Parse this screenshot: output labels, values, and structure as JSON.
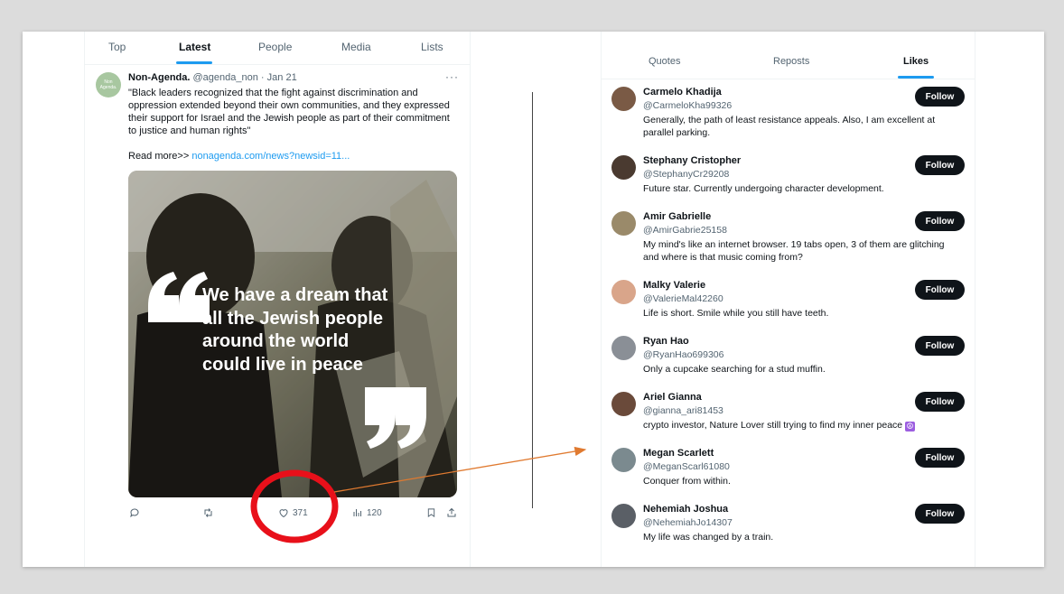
{
  "search_tabs": [
    "Top",
    "Latest",
    "People",
    "Media",
    "Lists"
  ],
  "tweet": {
    "avatar_text": "Non Agenda.",
    "author_name": "Non-Agenda.",
    "handle": "@agenda_non",
    "date": "Jan 21",
    "text": "\"Black leaders recognized that the fight against discrimination and oppression extended beyond their own communities, and they expressed their support for Israel and the Jewish people as part of their commitment to justice and human rights\"",
    "read_more": "Read more>>",
    "link": "nonagenda.com/news?newsid=11...",
    "image_quote": "We have a dream that all the Jewish people around the world could live in peace",
    "likes": "371",
    "views": "120"
  },
  "engagement_tabs": [
    "Quotes",
    "Reposts",
    "Likes"
  ],
  "follow_label": "Follow",
  "likers": [
    {
      "name": "Carmelo Khadija",
      "handle": "@CarmeloKha99326",
      "bio": "Generally, the path of least resistance appeals. Also, I am excellent at parallel parking.",
      "avatar_color": "#7a5a45"
    },
    {
      "name": "Stephany Cristopher",
      "handle": "@StephanyCr29208",
      "bio": "Future star. Currently undergoing character development.",
      "avatar_color": "#4a3a30"
    },
    {
      "name": "Amir Gabrielle",
      "handle": "@AmirGabrie25158",
      "bio": "My mind's like an internet browser. 19 tabs open, 3 of them are glitching and where is that music coming from?",
      "avatar_color": "#9a8a6a"
    },
    {
      "name": "Malky Valerie",
      "handle": "@ValerieMal42260",
      "bio": "Life is short. Smile while you still have teeth.",
      "avatar_color": "#d9a58a"
    },
    {
      "name": "Ryan Hao",
      "handle": "@RyanHao699306",
      "bio": "Only a cupcake searching for a stud muffin.",
      "avatar_color": "#8a8f96"
    },
    {
      "name": "Ariel Gianna",
      "handle": "@gianna_ari81453",
      "bio": "crypto investor, Nature Lover still trying to find my inner peace",
      "avatar_color": "#6a4a3a"
    },
    {
      "name": "Megan Scarlett",
      "handle": "@MeganScarl61080",
      "bio": "Conquer from within.",
      "avatar_color": "#7b8a8f"
    },
    {
      "name": "Nehemiah Joshua",
      "handle": "@NehemiahJo14307",
      "bio": "My life was changed by a train.",
      "avatar_color": "#5a5f66"
    }
  ],
  "colors": {
    "accent": "#1d9bf0",
    "annotation_circle": "#e8101a",
    "annotation_arrow": "#e07a30"
  }
}
